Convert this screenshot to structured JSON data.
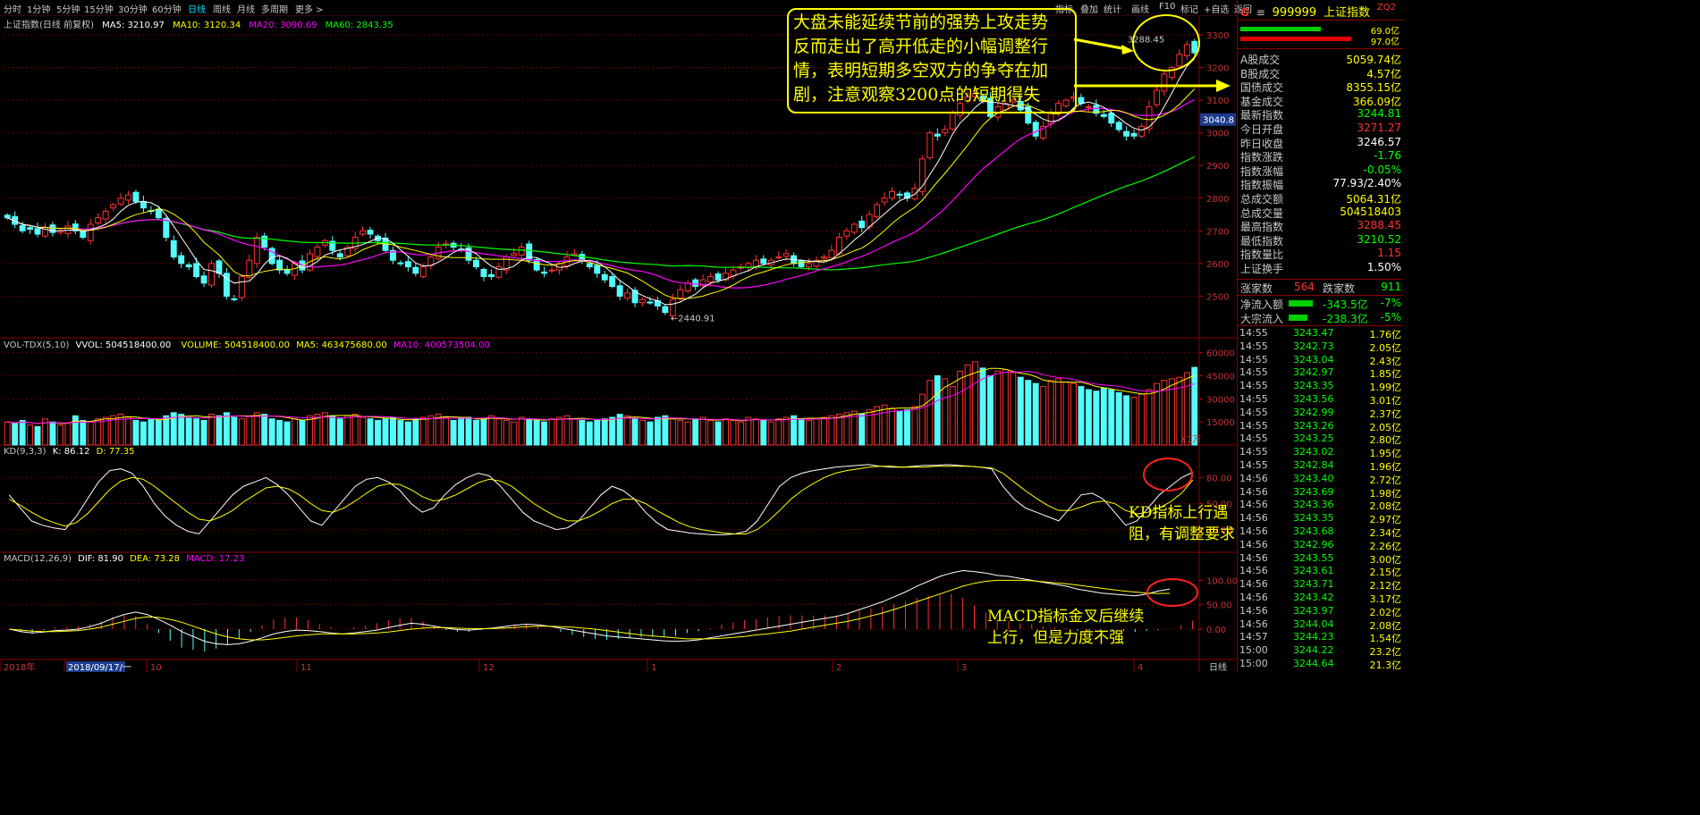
{
  "toolbar": {
    "periods": [
      "分时",
      "1分钟",
      "5分钟",
      "15分钟",
      "30分钟",
      "60分钟",
      "日线",
      "周线",
      "月线",
      "多周期",
      "更多 >"
    ],
    "active_period": "日线",
    "right_tools": [
      "指标",
      "叠加",
      "统计",
      "画线",
      "F10",
      "标记",
      "+自选",
      "返回"
    ]
  },
  "price_header": {
    "title": "上证指数(日线 前复权)",
    "ma5": "MA5: 3210.97",
    "ma10": "MA10: 3120.34",
    "ma20": "MA20: 3090.69",
    "ma60": "MA60: 2843.35"
  },
  "vol_header": {
    "name": "VOL-TDX(5,10)",
    "vvol": "VVOL: 504518400.00",
    "volume": "VOLUME: 504518400.00",
    "ma5": "MA5: 463475680.00",
    "ma10": "MA10: 400573504.00"
  },
  "kd_header": {
    "name": "KD(9,3,3)",
    "k": "K: 86.12",
    "d": "D: 77.35"
  },
  "macd_header": {
    "name": "MACD(12,26,9)",
    "dif": "DIF: 81.90",
    "dea": "DEA: 73.28",
    "macd": "MACD: 17.23"
  },
  "annotations": {
    "callout_top": [
      "大盘未能延续节前的强势上攻走势",
      "反而走出了高开低走的小幅调整行",
      "情，表明短期多空双方的争夺在加",
      "剧，注意观察3200点的短期得失"
    ],
    "kd_note": [
      "KD指标上行遇",
      "阻，有调整要求"
    ],
    "macd_note": [
      "MACD指标金叉后继续",
      "上行，但是力度不强"
    ],
    "high_label": "3288.45",
    "low_label": "2440.91",
    "vol_unit": "X1万",
    "current_tag": "3040.8"
  },
  "x_axis": {
    "labels": [
      "2018年",
      "2018/09/17/一",
      "10",
      "11",
      "12",
      "1",
      "2",
      "3",
      "4"
    ],
    "period_label": "日线"
  },
  "colors": {
    "up": "#ff3232",
    "down": "#54fcfc",
    "ma5": "#ffffff",
    "ma10": "#ffff00",
    "ma20": "#ff00ff",
    "ma60": "#00ff00",
    "grid": "#6a0000"
  },
  "panel": {
    "code": "999999",
    "name": "上证指数",
    "tag": "ZQ2",
    "bar_vals": [
      "69.0亿",
      "97.0亿"
    ],
    "rows": [
      {
        "label": "A股成交",
        "value": "5059.74亿",
        "color": "#ffff00"
      },
      {
        "label": "B股成交",
        "value": "4.57亿",
        "color": "#ffff00"
      },
      {
        "label": "国债成交",
        "value": "8355.15亿",
        "color": "#ffff00"
      },
      {
        "label": "基金成交",
        "value": "366.09亿",
        "color": "#ffff00"
      },
      {
        "label": "最新指数",
        "value": "3244.81",
        "color": "#00ff00"
      },
      {
        "label": "今日开盘",
        "value": "3271.27",
        "color": "#ff3232"
      },
      {
        "label": "昨日收盘",
        "value": "3246.57",
        "color": "#ffffff"
      },
      {
        "label": "指数涨跌",
        "value": "-1.76",
        "color": "#00ff00"
      },
      {
        "label": "指数涨幅",
        "value": "-0.05%",
        "color": "#00ff00"
      },
      {
        "label": "指数振幅",
        "value": "77.93/2.40%",
        "color": "#ffffff"
      },
      {
        "label": "总成交额",
        "value": "5064.31亿",
        "color": "#ffff00"
      },
      {
        "label": "总成交量",
        "value": "504518403",
        "color": "#ffff00"
      },
      {
        "label": "最高指数",
        "value": "3288.45",
        "color": "#ff3232"
      },
      {
        "label": "最低指数",
        "value": "3210.52",
        "color": "#00ff00"
      },
      {
        "label": "指数量比",
        "value": "1.15",
        "color": "#ff3232"
      },
      {
        "label": "上证换手",
        "value": "1.50%",
        "color": "#ffffff"
      }
    ],
    "updown": {
      "up_label": "涨家数",
      "up_value": "564",
      "down_label": "跌家数",
      "down_value": "911"
    },
    "flows": [
      {
        "label": "净流入额",
        "value": "-343.5亿",
        "pct": "-7%",
        "bar": 0.45
      },
      {
        "label": "大宗流入",
        "value": "-238.3亿",
        "pct": "-5%",
        "bar": 0.35
      }
    ],
    "ticks": [
      [
        "14:55",
        "3243.47",
        "1.76亿"
      ],
      [
        "14:55",
        "3242.73",
        "2.05亿"
      ],
      [
        "14:55",
        "3243.04",
        "2.43亿"
      ],
      [
        "14:55",
        "3242.97",
        "1.85亿"
      ],
      [
        "14:55",
        "3243.35",
        "1.99亿"
      ],
      [
        "14:55",
        "3243.56",
        "3.01亿"
      ],
      [
        "14:55",
        "3242.99",
        "2.37亿"
      ],
      [
        "14:55",
        "3243.26",
        "2.05亿"
      ],
      [
        "14:55",
        "3243.25",
        "2.80亿"
      ],
      [
        "14:55",
        "3243.02",
        "1.95亿"
      ],
      [
        "14:55",
        "3242.84",
        "1.96亿"
      ],
      [
        "14:56",
        "3243.40",
        "2.72亿"
      ],
      [
        "14:56",
        "3243.69",
        "1.98亿"
      ],
      [
        "14:56",
        "3243.36",
        "2.08亿"
      ],
      [
        "14:56",
        "3243.35",
        "2.97亿"
      ],
      [
        "14:56",
        "3243.68",
        "2.34亿"
      ],
      [
        "14:56",
        "3242.96",
        "2.26亿"
      ],
      [
        "14:56",
        "3243.55",
        "3.00亿"
      ],
      [
        "14:56",
        "3243.61",
        "2.15亿"
      ],
      [
        "14:56",
        "3243.71",
        "2.12亿"
      ],
      [
        "14:56",
        "3243.42",
        "3.17亿"
      ],
      [
        "14:56",
        "3243.97",
        "2.02亿"
      ],
      [
        "14:56",
        "3244.04",
        "2.08亿"
      ],
      [
        "14:57",
        "3244.23",
        "1.54亿"
      ],
      [
        "15:00",
        "3244.22",
        "23.2亿"
      ],
      [
        "15:00",
        "3244.64",
        "21.3亿"
      ]
    ]
  },
  "chart_data": [
    {
      "type": "candlestick",
      "title": "上证指数(日线 前复权)",
      "ylim": [
        2400,
        3330
      ],
      "yticks": [
        2500,
        2600,
        2700,
        2800,
        2900,
        3000,
        3100,
        3200,
        3300
      ],
      "high": 3288.45,
      "low": 2440.91,
      "series_names": [
        "MA5",
        "MA10",
        "MA20",
        "MA60"
      ],
      "closes": [
        2740,
        2720,
        2700,
        2705,
        2690,
        2710,
        2695,
        2700,
        2715,
        2700,
        2680,
        2720,
        2740,
        2760,
        2780,
        2800,
        2810,
        2790,
        2770,
        2760,
        2740,
        2680,
        2620,
        2600,
        2590,
        2560,
        2540,
        2600,
        2570,
        2500,
        2490,
        2560,
        2610,
        2680,
        2650,
        2600,
        2580,
        2570,
        2600,
        2580,
        2630,
        2650,
        2670,
        2640,
        2620,
        2650,
        2680,
        2700,
        2690,
        2670,
        2640,
        2610,
        2600,
        2590,
        2570,
        2590,
        2620,
        2650,
        2660,
        2650,
        2640,
        2610,
        2590,
        2560,
        2560,
        2590,
        2620,
        2630,
        2650,
        2610,
        2580,
        2570,
        2580,
        2600,
        2620,
        2630,
        2610,
        2590,
        2570,
        2550,
        2530,
        2500,
        2510,
        2480,
        2490,
        2480,
        2470,
        2450,
        2490,
        2520,
        2540,
        2530,
        2550,
        2560,
        2550,
        2570,
        2580,
        2590,
        2600,
        2610,
        2600,
        2610,
        2620,
        2630,
        2600,
        2590,
        2600,
        2610,
        2620,
        2640,
        2680,
        2700,
        2720,
        2710,
        2750,
        2780,
        2800,
        2820,
        2810,
        2800,
        2830,
        2920,
        3000,
        2990,
        3010,
        3060,
        3090,
        3110,
        3120,
        3100,
        3050,
        3080,
        3090,
        3100,
        3070,
        3030,
        2990,
        3020,
        3060,
        3090,
        3100,
        3110,
        3090,
        3080,
        3060,
        3050,
        3030,
        3010,
        2990,
        2990,
        3020,
        3080,
        3130,
        3180,
        3200,
        3240,
        3270,
        3244.81
      ],
      "volumes": [
        150,
        140,
        160,
        130,
        120,
        170,
        150,
        130,
        140,
        190,
        160,
        150,
        170,
        180,
        190,
        200,
        180,
        160,
        150,
        170,
        160,
        190,
        210,
        200,
        180,
        170,
        160,
        200,
        190,
        210,
        180,
        170,
        190,
        210,
        200,
        170,
        160,
        150,
        170,
        160,
        190,
        200,
        210,
        190,
        170,
        190,
        200,
        180,
        170,
        160,
        170,
        180,
        160,
        150,
        170,
        180,
        190,
        200,
        180,
        160,
        170,
        180,
        160,
        170,
        190,
        170,
        160,
        150,
        180,
        170,
        160,
        150,
        170,
        180,
        190,
        170,
        160,
        150,
        160,
        170,
        180,
        200,
        190,
        170,
        160,
        150,
        180,
        190,
        170,
        160,
        150,
        170,
        180,
        160,
        150,
        170,
        160,
        150,
        180,
        170,
        160,
        150,
        170,
        180,
        190,
        170,
        160,
        170,
        180,
        190,
        200,
        210,
        220,
        200,
        230,
        250,
        260,
        240,
        220,
        230,
        250,
        330,
        420,
        450,
        430,
        380,
        480,
        520,
        540,
        500,
        450,
        480,
        490,
        470,
        440,
        420,
        400,
        380,
        420,
        430,
        410,
        400,
        380,
        360,
        350,
        370,
        360,
        340,
        320,
        310,
        330,
        360,
        400,
        420,
        430,
        440,
        470,
        504.5
      ],
      "vol_unit": "X1万",
      "vol_yticks": [
        15000,
        30000,
        45000,
        60000
      ],
      "k": [
        60,
        45,
        30,
        25,
        22,
        20,
        35,
        55,
        75,
        88,
        90,
        85,
        70,
        50,
        35,
        25,
        18,
        15,
        30,
        45,
        60,
        70,
        75,
        80,
        72,
        60,
        45,
        30,
        25,
        40,
        55,
        70,
        78,
        80,
        75,
        65,
        50,
        40,
        45,
        60,
        72,
        80,
        85,
        82,
        70,
        55,
        40,
        30,
        25,
        20,
        22,
        30,
        45,
        60,
        70,
        65,
        55,
        40,
        28,
        20,
        18,
        16,
        15,
        14,
        14,
        15,
        18,
        30,
        50,
        70,
        80,
        85,
        88,
        90,
        92,
        93,
        94,
        95,
        93,
        92,
        92,
        93,
        94,
        94,
        95,
        94,
        93,
        92,
        90,
        70,
        55,
        45,
        40,
        35,
        30,
        45,
        60,
        62,
        55,
        40,
        25,
        30,
        45,
        60,
        70,
        80,
        86.12
      ],
      "d": [
        55,
        48,
        40,
        33,
        28,
        24,
        28,
        38,
        52,
        66,
        76,
        80,
        78,
        70,
        60,
        50,
        40,
        32,
        30,
        35,
        42,
        52,
        60,
        68,
        70,
        67,
        60,
        50,
        42,
        40,
        45,
        53,
        62,
        70,
        73,
        72,
        66,
        58,
        53,
        55,
        60,
        67,
        74,
        78,
        76,
        70,
        60,
        50,
        42,
        35,
        30,
        30,
        35,
        42,
        50,
        55,
        55,
        50,
        42,
        35,
        28,
        23,
        20,
        18,
        16,
        15,
        15,
        20,
        30,
        42,
        55,
        65,
        73,
        80,
        85,
        88,
        90,
        92,
        93,
        93,
        92,
        92,
        92,
        93,
        93,
        93,
        93,
        92,
        91,
        85,
        75,
        65,
        56,
        48,
        42,
        42,
        46,
        51,
        53,
        50,
        42,
        38,
        40,
        45,
        52,
        62,
        77.35
      ],
      "kd_yticks": [
        20,
        50,
        80
      ],
      "dif": [
        0,
        -5,
        -8,
        -6,
        -3,
        -2,
        0,
        5,
        12,
        22,
        30,
        35,
        30,
        20,
        8,
        -5,
        -15,
        -25,
        -30,
        -32,
        -30,
        -25,
        -18,
        -10,
        -5,
        -2,
        -3,
        -5,
        -8,
        -10,
        -8,
        -5,
        -2,
        3,
        8,
        12,
        10,
        6,
        2,
        -1,
        -2,
        0,
        2,
        5,
        8,
        10,
        9,
        6,
        2,
        -2,
        -6,
        -10,
        -14,
        -16,
        -18,
        -20,
        -22,
        -24,
        -25,
        -24,
        -22,
        -18,
        -14,
        -10,
        -6,
        -2,
        2,
        6,
        10,
        14,
        18,
        22,
        26,
        32,
        40,
        48,
        56,
        66,
        76,
        88,
        98,
        108,
        115,
        120,
        118,
        115,
        110,
        108,
        104,
        100,
        96,
        92,
        88,
        82,
        78,
        74,
        72,
        70,
        68,
        72,
        78,
        81.9
      ],
      "dea": [
        0,
        -2,
        -4,
        -5,
        -5,
        -4,
        -3,
        0,
        4,
        10,
        16,
        22,
        25,
        24,
        20,
        14,
        6,
        -2,
        -10,
        -16,
        -20,
        -22,
        -22,
        -20,
        -17,
        -14,
        -12,
        -10,
        -10,
        -10,
        -10,
        -9,
        -8,
        -6,
        -3,
        0,
        2,
        3,
        3,
        2,
        1,
        1,
        1,
        2,
        3,
        5,
        6,
        6,
        5,
        4,
        2,
        0,
        -3,
        -6,
        -9,
        -12,
        -14,
        -16,
        -18,
        -20,
        -20,
        -20,
        -19,
        -17,
        -15,
        -12,
        -10,
        -7,
        -4,
        0,
        4,
        8,
        12,
        16,
        21,
        27,
        33,
        40,
        48,
        56,
        64,
        72,
        80,
        88,
        94,
        98,
        100,
        100,
        100,
        99,
        97,
        95,
        93,
        90,
        87,
        84,
        81,
        78,
        76,
        74,
        73,
        73.28
      ],
      "macd": [
        0,
        -6,
        -8,
        -2,
        4,
        4,
        6,
        10,
        16,
        24,
        28,
        26,
        10,
        -8,
        -24,
        -38,
        -42,
        -46,
        -40,
        -32,
        -20,
        -6,
        8,
        20,
        24,
        24,
        18,
        10,
        4,
        0,
        4,
        8,
        12,
        18,
        22,
        24,
        16,
        6,
        -2,
        -6,
        -6,
        -2,
        2,
        6,
        10,
        10,
        6,
        0,
        -6,
        -12,
        -16,
        -20,
        -22,
        -20,
        -18,
        -16,
        -16,
        -16,
        -14,
        -8,
        -4,
        2,
        10,
        14,
        18,
        20,
        24,
        26,
        28,
        28,
        28,
        28,
        28,
        32,
        38,
        42,
        46,
        52,
        56,
        64,
        68,
        72,
        72,
        64,
        48,
        34,
        20,
        16,
        12,
        10,
        6,
        4,
        2,
        -4,
        -6,
        -6,
        -4,
        -4,
        -6,
        -4,
        -2,
        0,
        8,
        17.23
      ],
      "macd_yticks": [
        0,
        50,
        100
      ]
    }
  ]
}
